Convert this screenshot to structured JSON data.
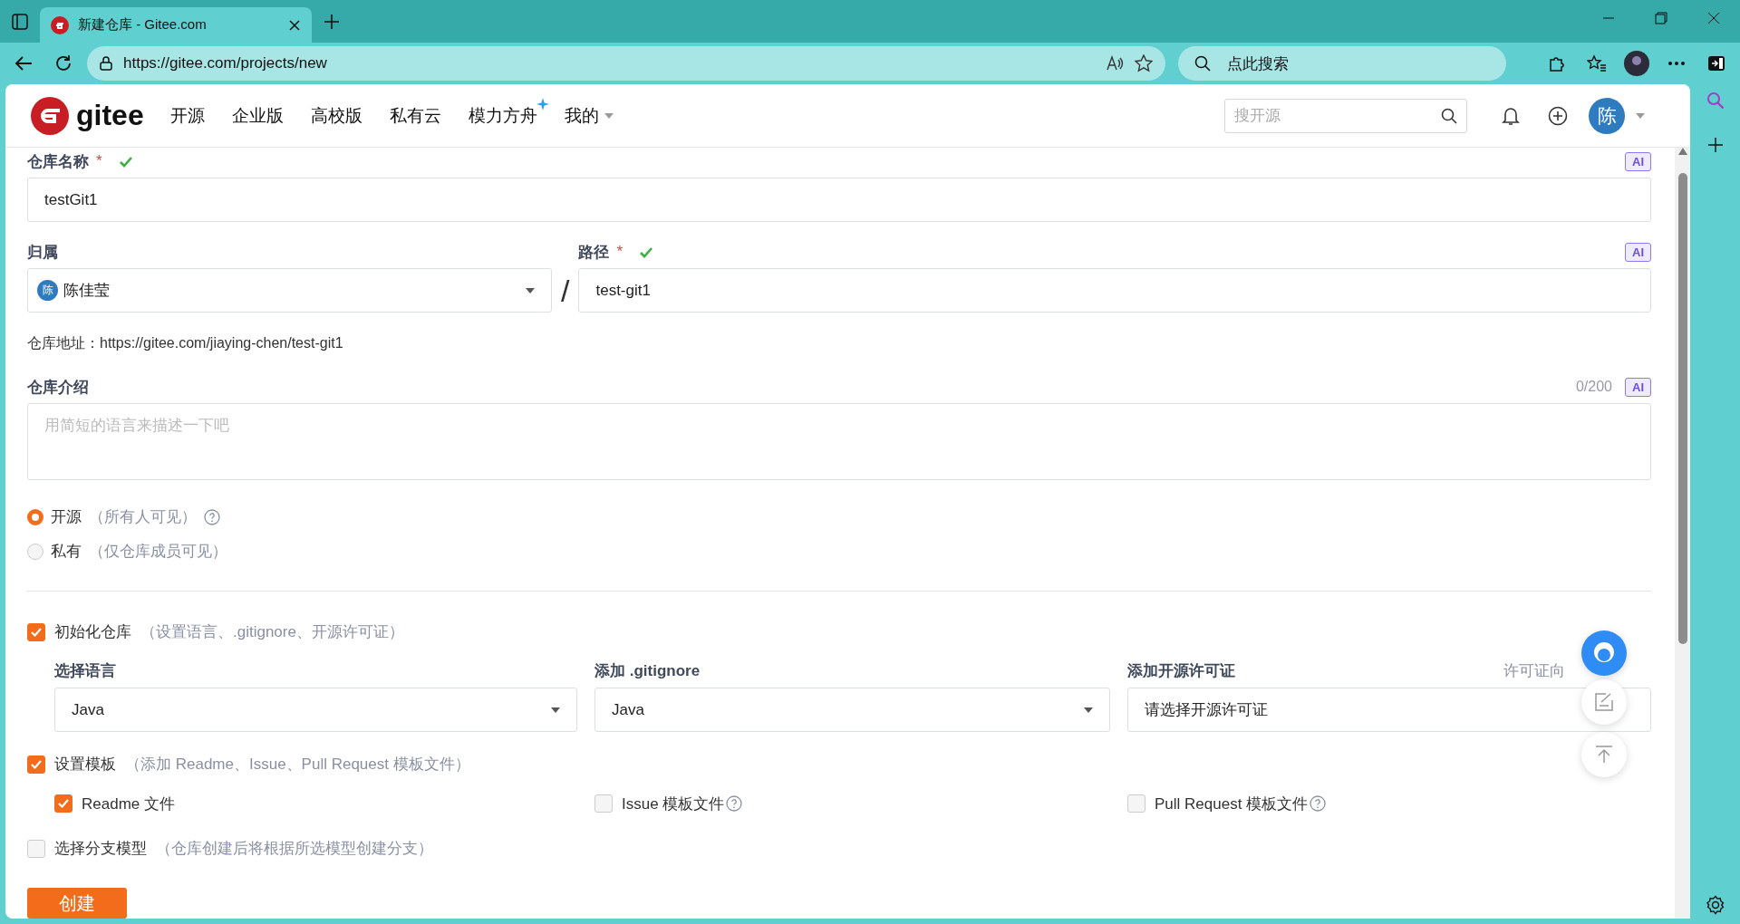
{
  "browser": {
    "tabs": [
      {
        "title": "新建仓库 - Gitee.com",
        "selected": true
      }
    ],
    "address_bar": {
      "url": "https://gitee.com/projects/new"
    },
    "search": {
      "placeholder": "点此搜索"
    }
  },
  "site_header": {
    "logo_text": "gitee",
    "nav": [
      {
        "label": "开源",
        "kind": "link"
      },
      {
        "label": "企业版",
        "kind": "link"
      },
      {
        "label": "高校版",
        "kind": "link"
      },
      {
        "label": "私有云",
        "kind": "link"
      },
      {
        "label": "模力方舟",
        "kind": "sparkle"
      },
      {
        "label": "我的",
        "kind": "dropdown"
      }
    ],
    "search": {
      "placeholder": "搜开源"
    },
    "avatar": "陈"
  },
  "form": {
    "repo_name": {
      "label": "仓库名称",
      "required": "*",
      "valid": true,
      "value": "testGit1",
      "ai": "AI"
    },
    "owner": {
      "label": "归属",
      "avatar": "陈",
      "value": "陈佳莹"
    },
    "separator": "/",
    "path": {
      "label": "路径",
      "required": "*",
      "valid": true,
      "value": "test-git1",
      "ai": "AI"
    },
    "repo_url": "仓库地址：https://gitee.com/jiaying-chen/test-git1",
    "description": {
      "label": "仓库介绍",
      "counter": "0/200",
      "ai": "AI",
      "placeholder": "用简短的语言来描述一下吧"
    },
    "visibility": [
      {
        "label": "开源",
        "note": "（所有人可见）",
        "help": true,
        "selected": true
      },
      {
        "label": "私有",
        "note": "（仅仓库成员可见）",
        "help": false,
        "selected": false
      }
    ],
    "init": {
      "label": "初始化仓库",
      "note": "（设置语言、.gitignore、开源许可证）",
      "checked": true
    },
    "init_fields": [
      {
        "label": "选择语言",
        "value": "Java",
        "kind": "select"
      },
      {
        "label": "添加 .gitignore",
        "value": "Java",
        "kind": "select"
      },
      {
        "label": "添加开源许可证",
        "value": "请选择开源许可证",
        "kind": "text",
        "link": "许可证向"
      }
    ],
    "templates": {
      "label": "设置模板",
      "note": "（添加 Readme、Issue、Pull Request 模板文件）",
      "checked": true
    },
    "template_files": [
      {
        "label": "Readme 文件",
        "checked": true,
        "help": false
      },
      {
        "label": "Issue 模板文件",
        "checked": false,
        "help": true
      },
      {
        "label": "Pull Request 模板文件",
        "checked": false,
        "help": true
      }
    ],
    "branch_model": {
      "label": "选择分支模型",
      "note": "（仓库创建后将根据所选模型创建分支）",
      "checked": false
    },
    "submit": "创建"
  }
}
